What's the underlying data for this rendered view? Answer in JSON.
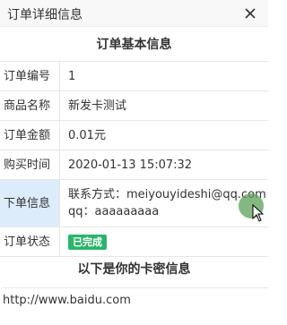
{
  "dialog": {
    "title": "订单详细信息",
    "close_icon": "close-icon"
  },
  "section1": {
    "title": "订单基本信息"
  },
  "rows": [
    {
      "label": "订单编号",
      "value": "1"
    },
    {
      "label": "商品名称",
      "value": "新发卡测试"
    },
    {
      "label": "订单金额",
      "value": "0.01元"
    },
    {
      "label": "购买时间",
      "value": "2020-01-13 15:07:32"
    },
    {
      "label": "下单信息",
      "line1": "联系方式：meiyouyideshi@qq.com",
      "line2": "qq：aaaaaaaaa"
    },
    {
      "label": "订单状态",
      "badge": "已完成"
    }
  ],
  "section2": {
    "title": "以下是你的卡密信息"
  },
  "card_info": {
    "text": "http://www.baidu.com"
  },
  "colors": {
    "badge": "#2ab56b",
    "highlight": "#dcecfb"
  }
}
